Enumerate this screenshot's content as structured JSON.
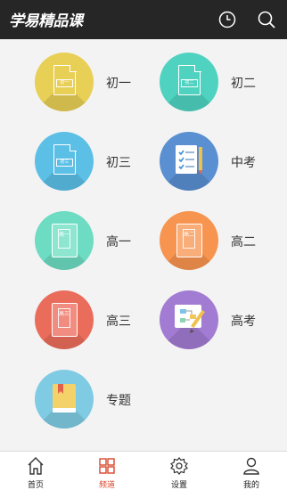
{
  "app": {
    "logo_text": "学易精品课"
  },
  "header": {
    "history_icon": "clock-icon",
    "search_icon": "search-icon"
  },
  "tiles": [
    {
      "label": "初一",
      "icon": "document-icon",
      "icon_text": "初一",
      "color": "#e8cf55"
    },
    {
      "label": "初二",
      "icon": "document-icon",
      "icon_text": "初二",
      "color": "#4fd3c0"
    },
    {
      "label": "初三",
      "icon": "document-icon",
      "icon_text": "初三",
      "color": "#5bbfe6"
    },
    {
      "label": "中考",
      "icon": "checklist-icon",
      "icon_text": "",
      "color": "#5a8fd1"
    },
    {
      "label": "高一",
      "icon": "book-icon",
      "icon_text": "高一",
      "color": "#6ddcc2"
    },
    {
      "label": "高二",
      "icon": "book-icon",
      "icon_text": "高二",
      "color": "#f7944f"
    },
    {
      "label": "高三",
      "icon": "book-icon",
      "icon_text": "高三",
      "color": "#ea6d5c"
    },
    {
      "label": "高考",
      "icon": "whiteboard-icon",
      "icon_text": "",
      "color": "#a27bd2"
    },
    {
      "label": "专题",
      "icon": "bookmark-book-icon",
      "icon_text": "",
      "color": "#7fcbe3"
    }
  ],
  "tabbar": {
    "items": [
      {
        "label": "首页",
        "icon": "home-icon",
        "active": false
      },
      {
        "label": "频道",
        "icon": "grid-icon",
        "active": true
      },
      {
        "label": "设置",
        "icon": "gear-icon",
        "active": false
      },
      {
        "label": "我的",
        "icon": "user-icon",
        "active": false
      }
    ],
    "active_color": "#d9452c"
  }
}
